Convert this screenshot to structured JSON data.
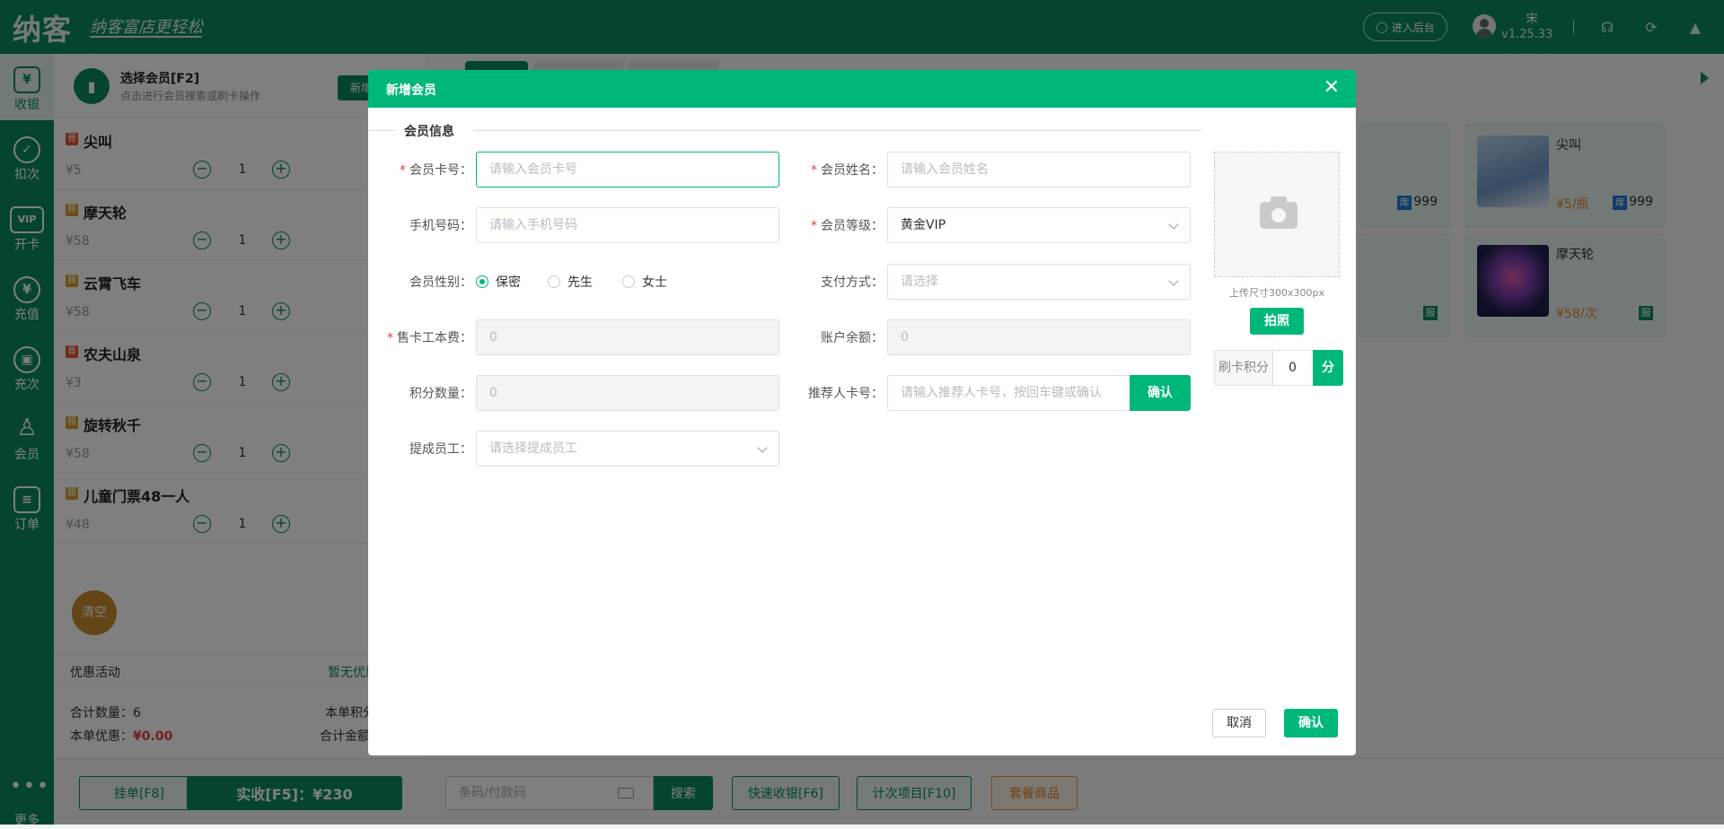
{
  "topbar": {
    "logo": "纳客",
    "slogan": "纳客富店更轻松",
    "backend_button": "进入后台",
    "user_name": "宋",
    "version": "v1.25.33"
  },
  "sidebar": {
    "items": [
      {
        "icon": "¥",
        "label": "收银"
      },
      {
        "icon": "✓",
        "label": "扣次"
      },
      {
        "icon": "VIP",
        "label": "开卡"
      },
      {
        "icon": "¥",
        "label": "充值"
      },
      {
        "icon": "▣",
        "label": "充次"
      },
      {
        "icon": "♙",
        "label": "会员"
      },
      {
        "icon": "≡",
        "label": "订单"
      }
    ],
    "more_label": "更多"
  },
  "left_panel": {
    "member_title": "选择会员[F2]",
    "member_sub": "点击进行会员搜索或刷卡操作",
    "new_button": "新增",
    "goods": [
      {
        "badge": "普",
        "badge_color": "#e2542a",
        "name": "尖叫",
        "price": "¥5",
        "qty": "1"
      },
      {
        "badge": "服",
        "badge_color": "#d99a2b",
        "name": "摩天轮",
        "price": "¥58",
        "qty": "1"
      },
      {
        "badge": "服",
        "badge_color": "#d99a2b",
        "name": "云霄飞车",
        "price": "¥58",
        "qty": "1"
      },
      {
        "badge": "普",
        "badge_color": "#e2542a",
        "name": "农夫山泉",
        "price": "¥3",
        "qty": "1"
      },
      {
        "badge": "服",
        "badge_color": "#d99a2b",
        "name": "旋转秋千",
        "price": "¥58",
        "qty": "1"
      },
      {
        "badge": "服",
        "badge_color": "#d99a2b",
        "name": "儿童门票48一人",
        "price": "¥48",
        "qty": "1"
      }
    ],
    "clear_button": "清空",
    "promo_label": "优惠活动",
    "promo_value": "暂无优惠",
    "total_qty": "合计数量：6",
    "points": "本单积分",
    "discount_label": "本单优惠：",
    "discount_value": "¥0.00",
    "total_amount": "合计金额"
  },
  "bottom_bar": {
    "hang_button": "挂单[F8]",
    "pay_button": "实收[F5]：¥230",
    "barcode_placeholder": "条码/付款码",
    "search_button": "搜索",
    "quick_button": "快速收银[F6]",
    "count_button": "计次项目[F10]",
    "package_button": "套餐商品"
  },
  "product_cards": [
    {
      "name": "尖叫",
      "price": "¥5/瓶",
      "stock_badge": "库",
      "stock": "999"
    },
    {
      "name": "摩天轮",
      "price": "¥58/次",
      "service_badge": "服"
    }
  ],
  "partial_cards": [
    {
      "stock_badge": "库",
      "stock": "999"
    },
    {
      "service_badge": "服"
    }
  ],
  "modal": {
    "title": "新增会员",
    "close": "✕",
    "section": "会员信息",
    "card_no_label": "会员卡号：",
    "card_no_placeholder": "请输入会员卡号",
    "name_label": "会员姓名：",
    "name_placeholder": "请输入会员姓名",
    "phone_label": "手机号码：",
    "phone_placeholder": "请输入手机号码",
    "level_label": "会员等级：",
    "level_value": "黄金VIP",
    "gender_label": "会员性别：",
    "gender_options": [
      "保密",
      "先生",
      "女士"
    ],
    "gender_selected": "保密",
    "pay_label": "支付方式：",
    "pay_placeholder": "请选择",
    "fee_label": "售卡工本费：",
    "fee_value": "0",
    "balance_label": "账户余额：",
    "balance_value": "0",
    "points_label": "积分数量：",
    "points_value": "0",
    "referrer_label": "推荐人卡号：",
    "referrer_placeholder": "请输入推荐人卡号，按回车键或确认",
    "referrer_confirm": "确认",
    "staff_label": "提成员工：",
    "staff_placeholder": "请选择提成员工",
    "photo_hint": "上传尺寸300x300px",
    "photo_button": "拍照",
    "card_points_label": "刷卡积分",
    "card_points_value": "0",
    "card_points_unit": "分",
    "cancel_button": "取消",
    "confirm_button": "确认"
  }
}
